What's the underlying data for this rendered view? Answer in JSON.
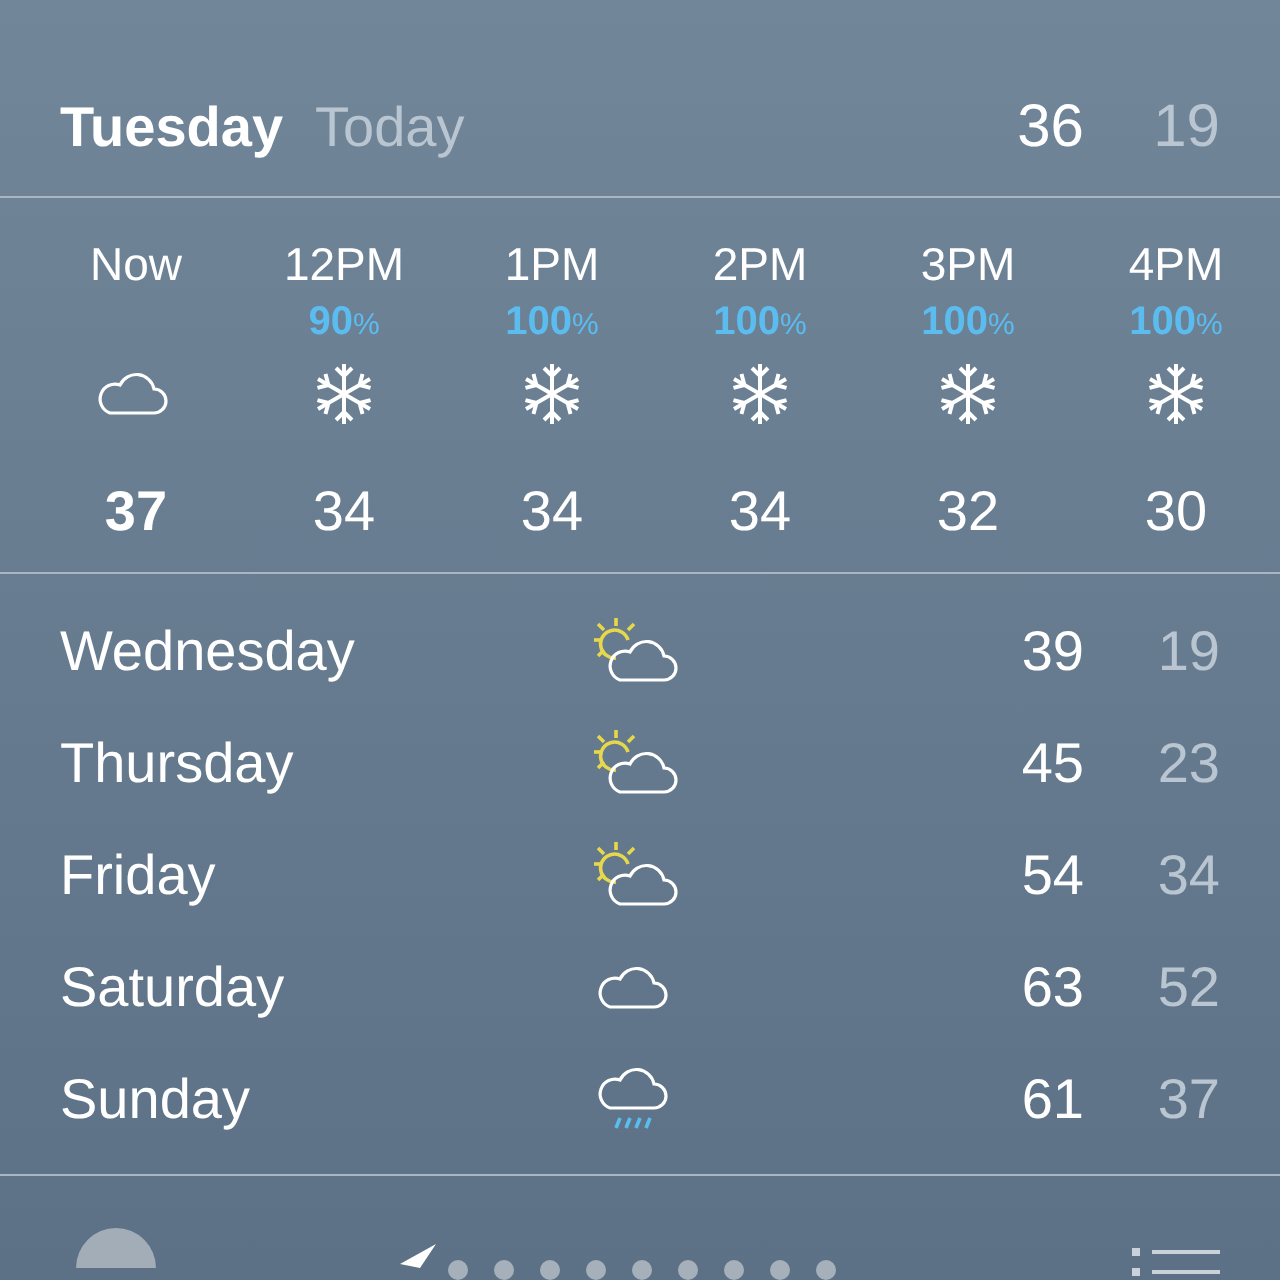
{
  "today": {
    "day": "Tuesday",
    "label": "Today",
    "high": "36",
    "low": "19"
  },
  "hourly": [
    {
      "time": "Now",
      "kind": "cloud",
      "temp": "37",
      "selected": true
    },
    {
      "time": "12PM",
      "chance": "90",
      "chance_unit": "%",
      "kind": "snow",
      "temp": "34",
      "selected": false
    },
    {
      "time": "1PM",
      "chance": "100",
      "chance_unit": "%",
      "kind": "snow",
      "temp": "34",
      "selected": false
    },
    {
      "time": "2PM",
      "chance": "100",
      "chance_unit": "%",
      "kind": "snow",
      "temp": "34",
      "selected": false
    },
    {
      "time": "3PM",
      "chance": "100",
      "chance_unit": "%",
      "kind": "snow",
      "temp": "32",
      "selected": false
    },
    {
      "time": "4PM",
      "chance": "100",
      "chance_unit": "%",
      "kind": "snow",
      "temp": "30",
      "selected": false
    }
  ],
  "daily": [
    {
      "day": "Wednesday",
      "kind": "partly",
      "high": "39",
      "low": "19"
    },
    {
      "day": "Thursday",
      "kind": "partly",
      "high": "45",
      "low": "23"
    },
    {
      "day": "Friday",
      "kind": "partly",
      "high": "54",
      "low": "34"
    },
    {
      "day": "Saturday",
      "kind": "cloud",
      "high": "63",
      "low": "52"
    },
    {
      "day": "Sunday",
      "kind": "rain",
      "high": "61",
      "low": "37"
    }
  ]
}
